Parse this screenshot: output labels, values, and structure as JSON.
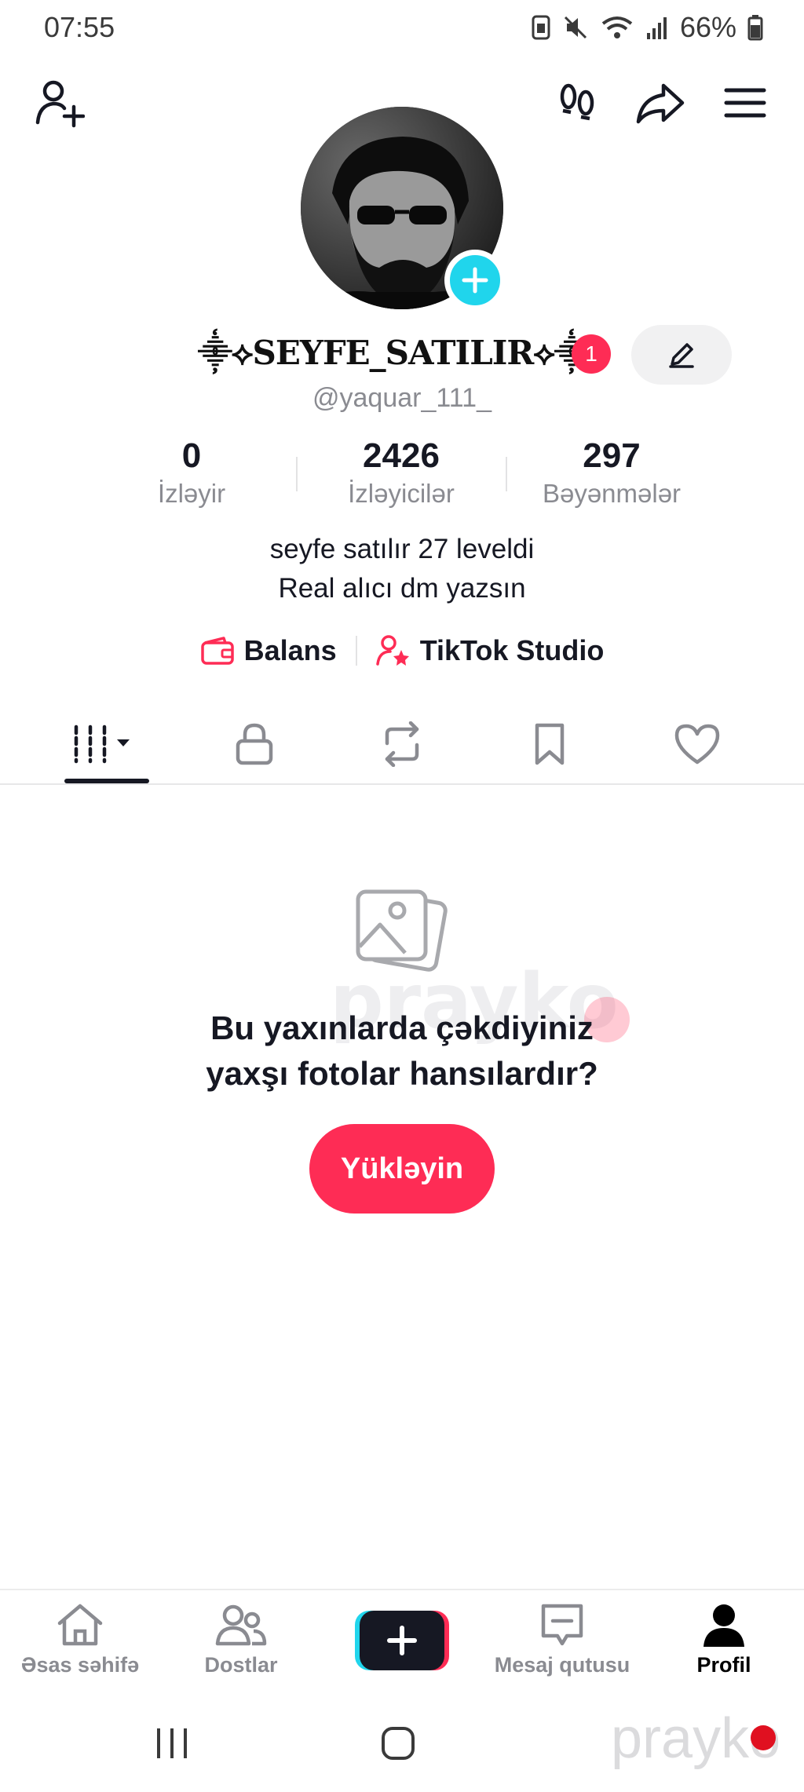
{
  "status_bar": {
    "time": "07:55",
    "battery": "66%"
  },
  "profile": {
    "display_name": "⸎⟡SEYFE_SATILIR⟡⸎",
    "notification_count": "1",
    "username": "@yaquar_111_",
    "stats": [
      {
        "value": "0",
        "label": "İzləyir"
      },
      {
        "value": "2426",
        "label": "İzləyicilər"
      },
      {
        "value": "297",
        "label": "Bəyənmələr"
      }
    ],
    "bio_line1": "seyfe satılır 27 leveldi",
    "bio_line2": "Real alıcı dm yazsın",
    "links": {
      "balance": "Balans",
      "studio": "TikTok Studio"
    }
  },
  "empty_state": {
    "line1": "Bu yaxınlarda çəkdiyiniz",
    "line2": "yaxşı fotolar hansılardır?",
    "button": "Yükləyin"
  },
  "watermark": "prayko",
  "bottom_nav": [
    {
      "label": "Əsas səhifə",
      "icon": "home-icon"
    },
    {
      "label": "Dostlar",
      "icon": "friends-icon"
    },
    {
      "label": "",
      "icon": "plus-icon"
    },
    {
      "label": "Mesaj qutusu",
      "icon": "inbox-icon"
    },
    {
      "label": "Profil",
      "icon": "profile-icon"
    }
  ],
  "colors": {
    "accent": "#fe2c55",
    "cyan": "#20d5ec",
    "text": "#161823",
    "muted": "#8a8b91"
  }
}
